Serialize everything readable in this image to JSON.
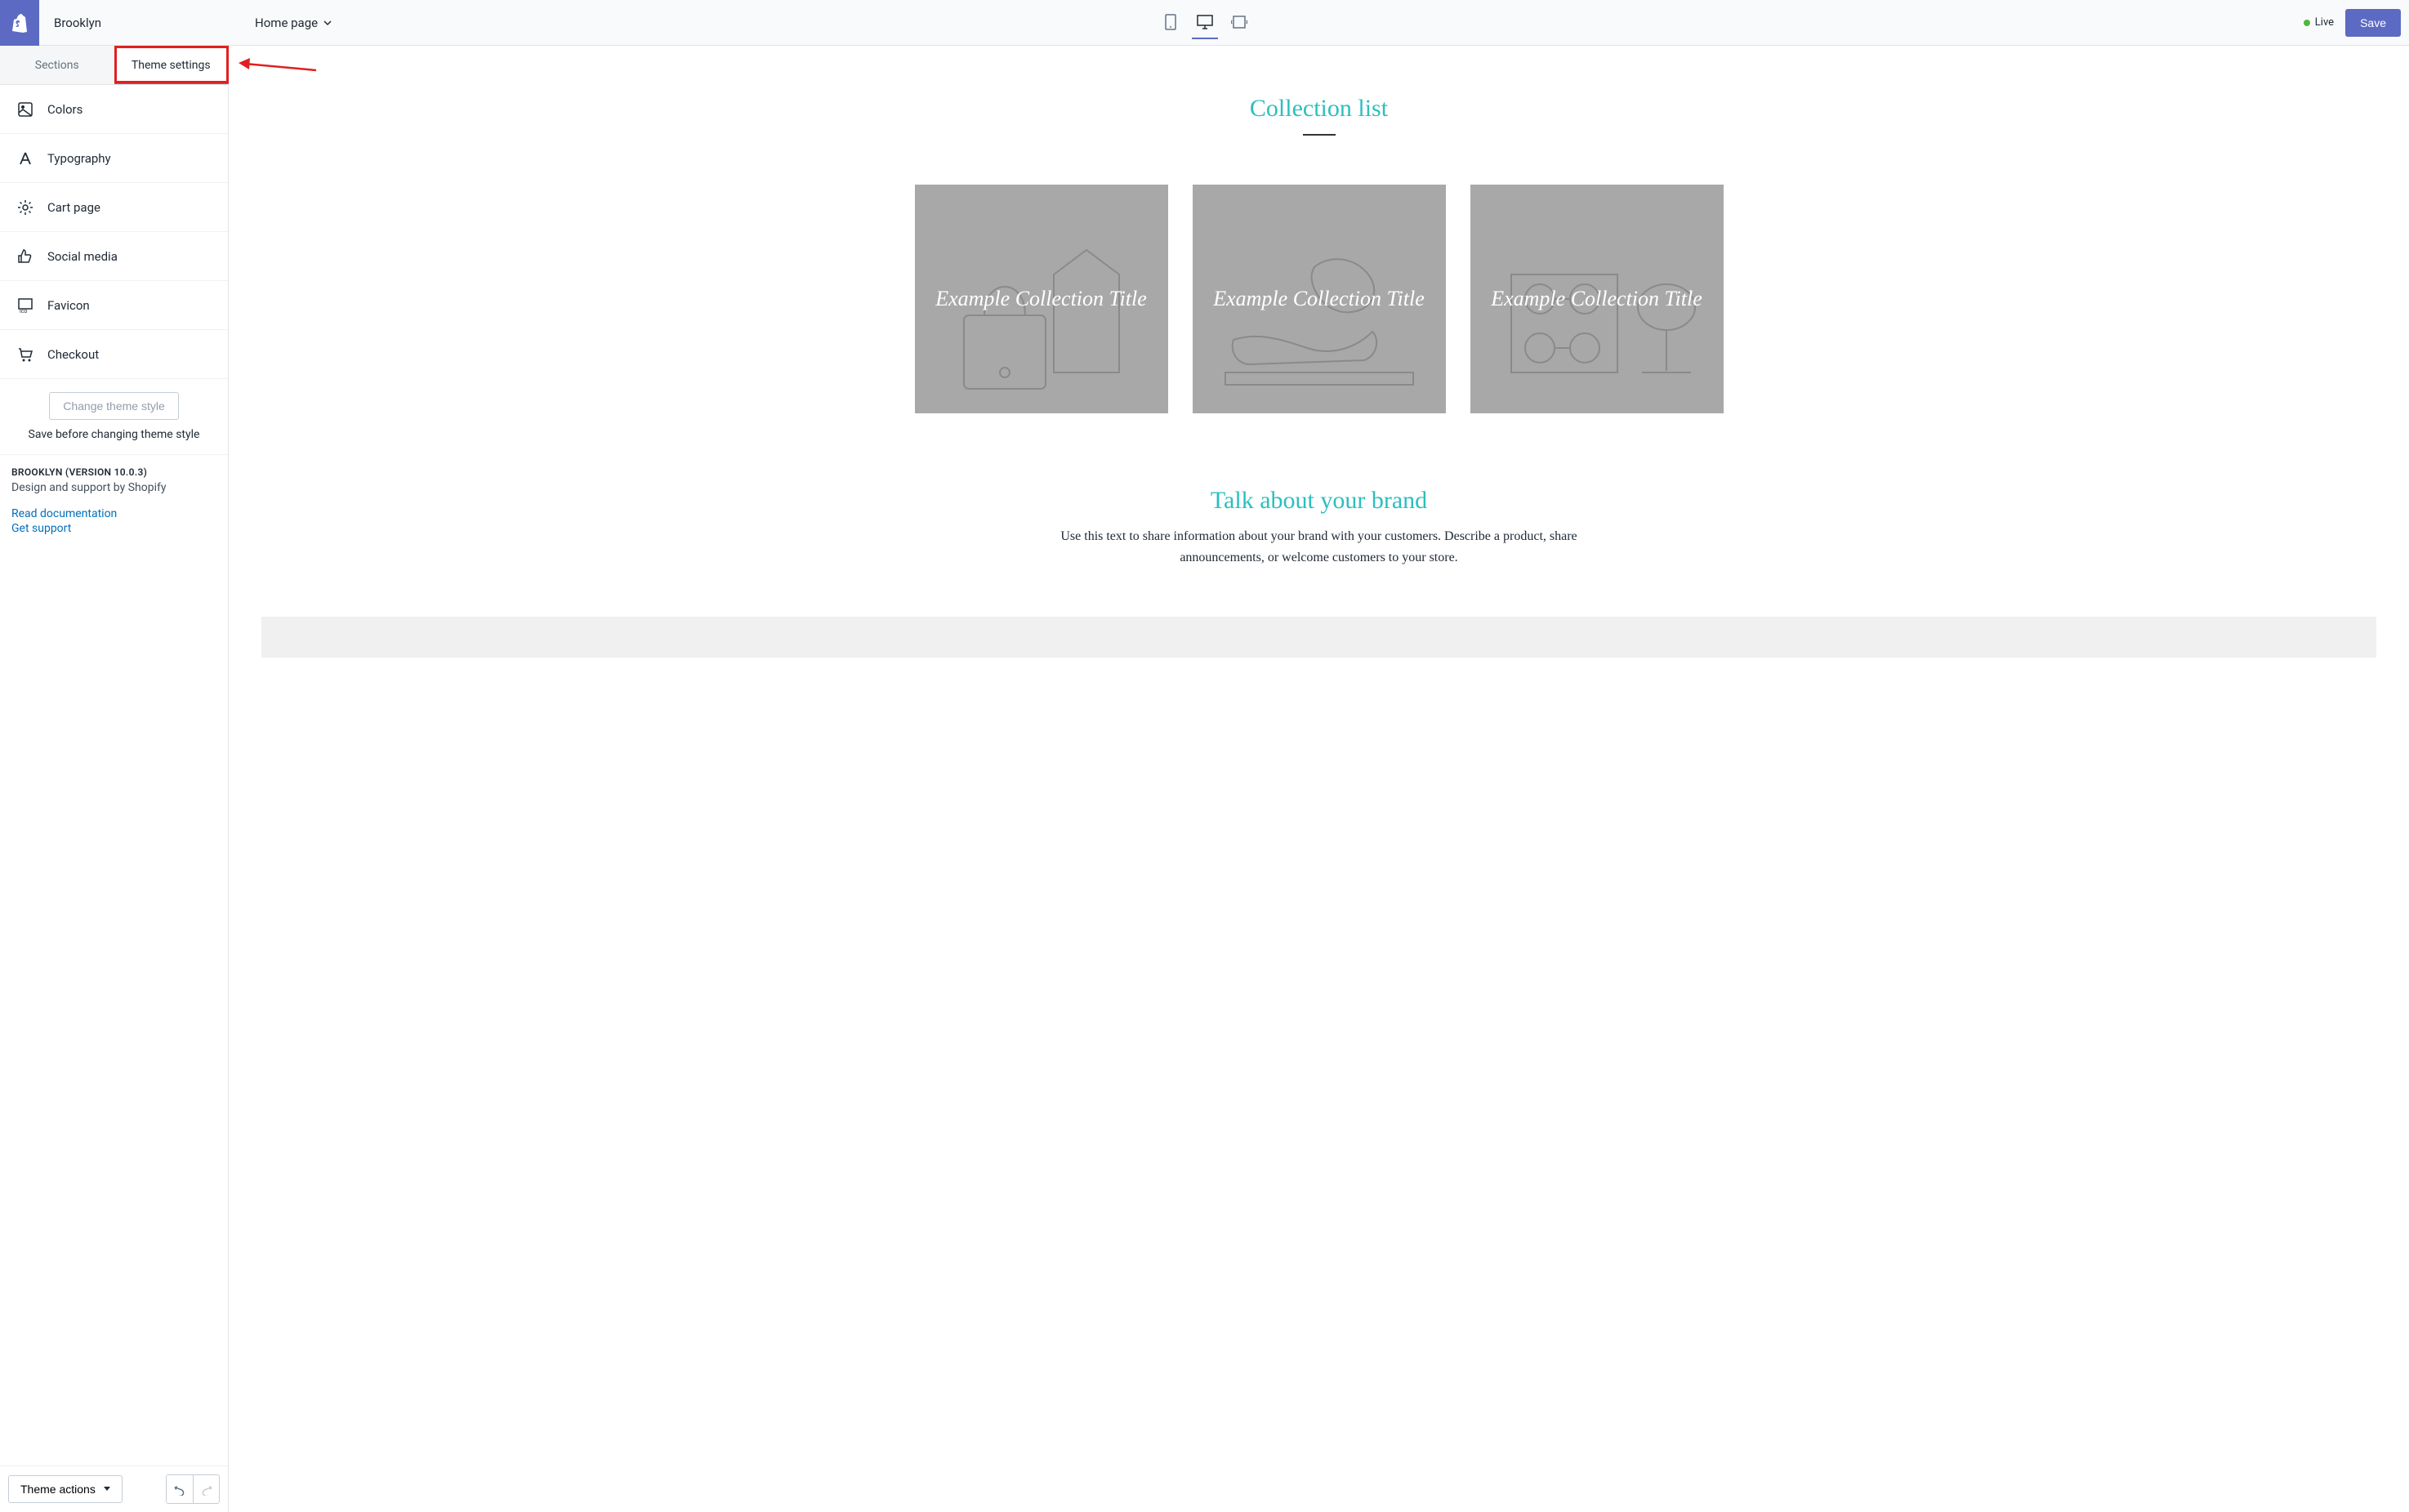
{
  "topbar": {
    "theme_name": "Brooklyn",
    "page": "Home page",
    "live": "Live",
    "save": "Save"
  },
  "tabs": {
    "sections": "Sections",
    "theme_settings": "Theme settings"
  },
  "settings": {
    "items": [
      {
        "label": "Colors"
      },
      {
        "label": "Typography"
      },
      {
        "label": "Cart page"
      },
      {
        "label": "Social media"
      },
      {
        "label": "Favicon"
      },
      {
        "label": "Checkout"
      }
    ]
  },
  "change_style": {
    "button": "Change theme style",
    "note": "Save before changing theme style"
  },
  "meta": {
    "title": "BROOKLYN (VERSION 10.0.3)",
    "subtitle": "Design and support by Shopify",
    "doc_link": "Read documentation",
    "support_link": "Get support"
  },
  "bottom": {
    "theme_actions": "Theme actions"
  },
  "preview": {
    "collection_heading": "Collection list",
    "cards": [
      {
        "title": "Example Collection Title"
      },
      {
        "title": "Example Collection Title"
      },
      {
        "title": "Example Collection Title"
      }
    ],
    "brand_heading": "Talk about your brand",
    "brand_text": "Use this text to share information about your brand with your customers. Describe a product, share announcements, or welcome customers to your store."
  }
}
